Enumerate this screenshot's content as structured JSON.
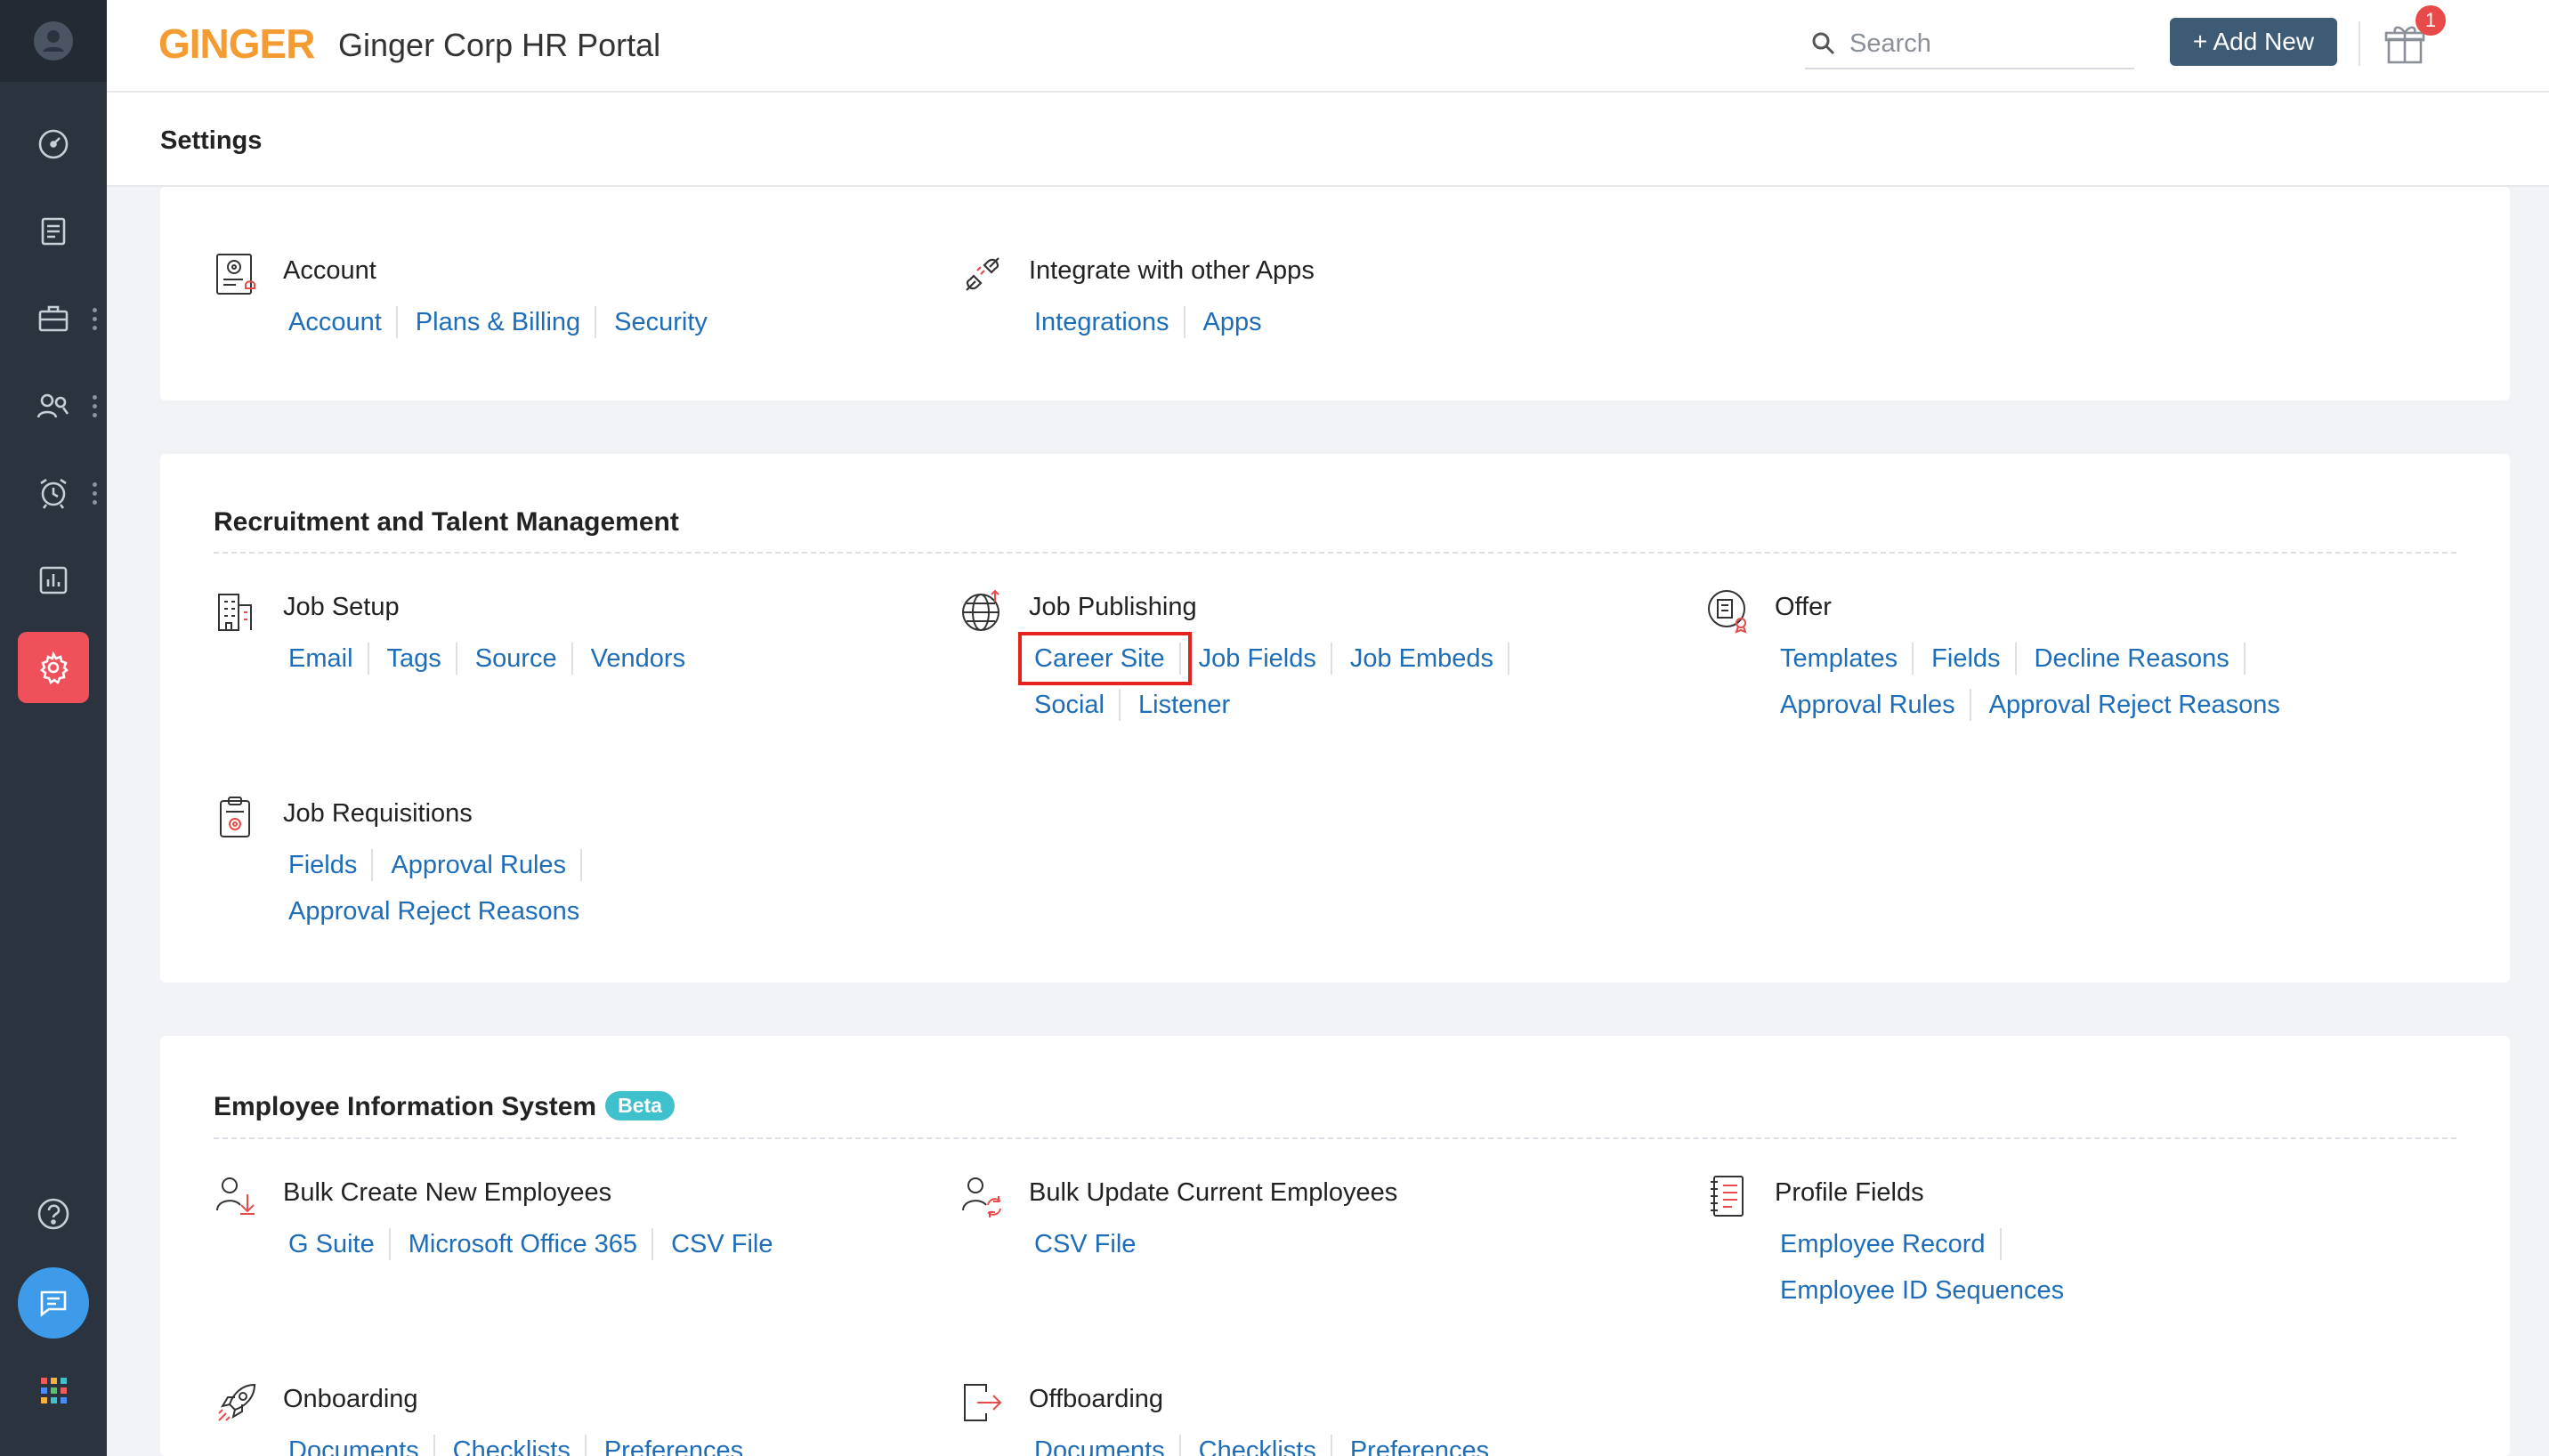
{
  "app": {
    "brand": "GINGER",
    "portal_title": "Ginger Corp HR Portal",
    "search_placeholder": "Search",
    "add_new_label": "+ Add New",
    "notification_count": "1"
  },
  "page_title": "Settings",
  "sidebar": {
    "items": [
      "dashboard",
      "requisitions",
      "jobs",
      "candidates",
      "interviews",
      "reports",
      "settings"
    ],
    "bottom": [
      "help",
      "chat",
      "apps"
    ]
  },
  "top_card": {
    "account": {
      "title": "Account",
      "links": [
        "Account",
        "Plans & Billing",
        "Security"
      ]
    },
    "integrate": {
      "title": "Integrate with other Apps",
      "links": [
        "Integrations",
        "Apps"
      ]
    }
  },
  "recruitment": {
    "title": "Recruitment and Talent Management",
    "job_setup": {
      "title": "Job Setup",
      "links": [
        "Email",
        "Tags",
        "Source",
        "Vendors"
      ]
    },
    "job_publishing": {
      "title": "Job Publishing",
      "links": [
        "Career Site",
        "Job Fields",
        "Job Embeds",
        "Social",
        "Listener"
      ]
    },
    "offer": {
      "title": "Offer",
      "links": [
        "Templates",
        "Fields",
        "Decline Reasons",
        "Approval Rules",
        "Approval Reject Reasons"
      ]
    },
    "job_requisitions": {
      "title": "Job Requisitions",
      "links": [
        "Fields",
        "Approval Rules",
        "Approval Reject Reasons"
      ]
    }
  },
  "employee": {
    "title": "Employee Information System",
    "badge": "Beta",
    "bulk_create": {
      "title": "Bulk Create New Employees",
      "links": [
        "G Suite",
        "Microsoft Office 365",
        "CSV File"
      ]
    },
    "bulk_update": {
      "title": "Bulk Update Current Employees",
      "links": [
        "CSV File"
      ]
    },
    "profile_fields": {
      "title": "Profile Fields",
      "links": [
        "Employee Record",
        "Employee ID Sequences"
      ]
    },
    "onboarding": {
      "title": "Onboarding",
      "links": [
        "Documents",
        "Checklists",
        "Preferences"
      ]
    },
    "offboarding": {
      "title": "Offboarding",
      "links": [
        "Documents",
        "Checklists",
        "Preferences"
      ]
    }
  },
  "colors": {
    "sidebar": "#2b333f",
    "active_item": "#f0505a",
    "link": "#1e6db9",
    "brand": "#f49b32",
    "highlight_box": "#e5231c"
  }
}
